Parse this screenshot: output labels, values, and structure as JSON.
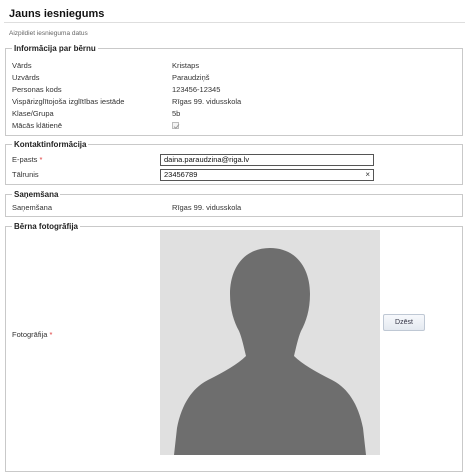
{
  "page": {
    "title": "Jauns iesniegums",
    "subtitle": "Aizpildiet iesnieguma datus"
  },
  "child_info": {
    "legend": "Informācija par bērnu",
    "fields": [
      {
        "label": "Vārds",
        "value": "Kristaps"
      },
      {
        "label": "Uzvārds",
        "value": "Paraudziņš"
      },
      {
        "label": "Personas kods",
        "value": "123456-12345"
      },
      {
        "label": "Vispārizglītojoša izglītības iestāde",
        "value": "Rīgas 99. vidusskola"
      },
      {
        "label": "Klase/Grupa",
        "value": "5b"
      },
      {
        "label": "Mācās klātienē",
        "checked": true
      }
    ]
  },
  "contact": {
    "legend": "Kontaktinformācija",
    "email_label": "E-pasts",
    "email_value": "daina.paraudzina@riga.lv",
    "phone_label": "Tālrunis",
    "phone_value": "23456789",
    "clear_glyph": "×",
    "required_mark": "*"
  },
  "receipt": {
    "legend": "Saņemšana",
    "label": "Saņemšana",
    "value": "Rīgas 99. vidusskola"
  },
  "photo": {
    "legend": "Bērna fotogrāfija",
    "label": "Fotogrāfija",
    "required_mark": "*",
    "button_label": "Dzēst",
    "placeholder_icon": "person-silhouette-icon"
  },
  "colors": {
    "required": "#dd3333",
    "photo_bg": "#e0e0e0",
    "silhouette": "#6e6e6e"
  }
}
